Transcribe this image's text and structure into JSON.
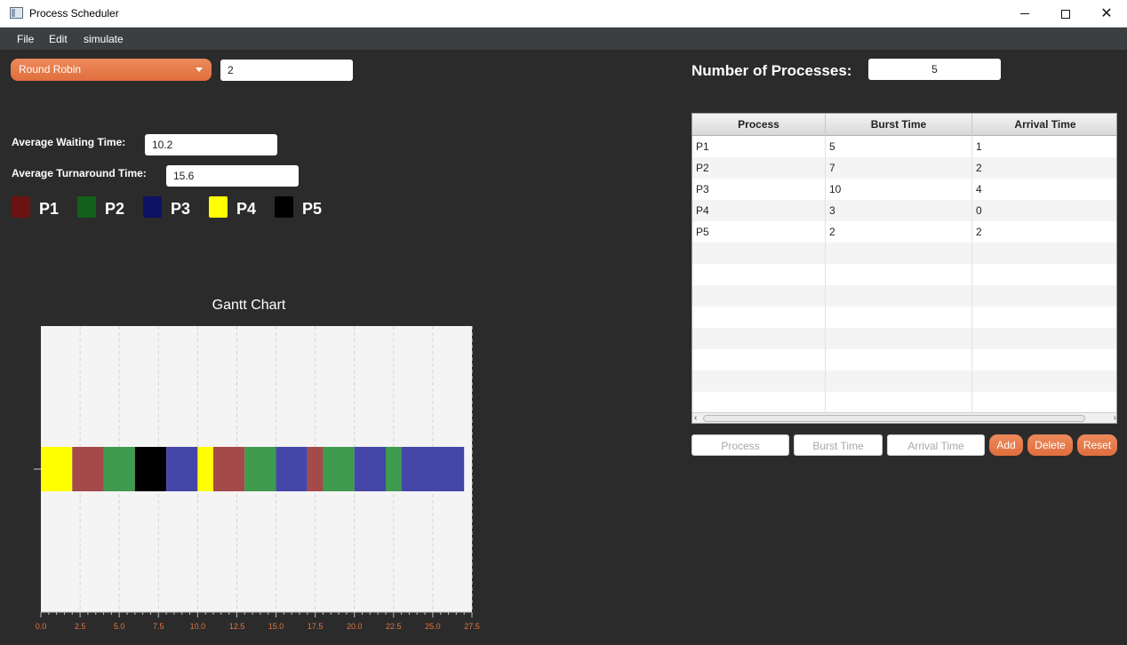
{
  "window": {
    "title": "Process Scheduler"
  },
  "menu": {
    "items": [
      "File",
      "Edit",
      "simulate"
    ]
  },
  "scheduler": {
    "algorithm": "Round Robin",
    "quantum": "2"
  },
  "stats": {
    "avg_waiting_label": "Average Waiting Time:",
    "avg_waiting_value": "10.2",
    "avg_turnaround_label": "Average Turnaround Time:",
    "avg_turnaround_value": "15.6"
  },
  "legend": [
    {
      "label": "P1",
      "color": "#6b1313"
    },
    {
      "label": "P2",
      "color": "#12601b"
    },
    {
      "label": "P3",
      "color": "#0e1264"
    },
    {
      "label": "P4",
      "color": "#ffff00"
    },
    {
      "label": "P5",
      "color": "#000000"
    }
  ],
  "processes_header": {
    "label": "Number of Processes:",
    "value": "5"
  },
  "table": {
    "columns": [
      "Process",
      "Burst Time",
      "Arrival Time"
    ],
    "rows": [
      [
        "P1",
        "5",
        "1"
      ],
      [
        "P2",
        "7",
        "2"
      ],
      [
        "P3",
        "10",
        "4"
      ],
      [
        "P4",
        "3",
        "0"
      ],
      [
        "P5",
        "2",
        "2"
      ]
    ]
  },
  "inputs": {
    "process_placeholder": "Process",
    "burst_placeholder": "Burst Time",
    "arrival_placeholder": "Arrival Time"
  },
  "buttons": {
    "add": "Add",
    "delete": "Delete",
    "reset": "Reset"
  },
  "chart_data": {
    "type": "gantt",
    "title": "Gantt Chart",
    "xlim": [
      0,
      27.5
    ],
    "xticks": [
      "0.0",
      "2.5",
      "5.0",
      "7.5",
      "10.0",
      "12.5",
      "15.0",
      "17.5",
      "20.0",
      "22.5",
      "25.0",
      "27.5"
    ],
    "segments": [
      {
        "process": "P4",
        "start": 0,
        "end": 2,
        "color": "#ffff00"
      },
      {
        "process": "P1",
        "start": 2,
        "end": 4,
        "color": "#a44a4a"
      },
      {
        "process": "P2",
        "start": 4,
        "end": 6,
        "color": "#3f9b4d"
      },
      {
        "process": "P5",
        "start": 6,
        "end": 8,
        "color": "#000000"
      },
      {
        "process": "P3",
        "start": 8,
        "end": 10,
        "color": "#4646a8"
      },
      {
        "process": "P4",
        "start": 10,
        "end": 11,
        "color": "#ffff00"
      },
      {
        "process": "P1",
        "start": 11,
        "end": 13,
        "color": "#a44a4a"
      },
      {
        "process": "P2",
        "start": 13,
        "end": 15,
        "color": "#3f9b4d"
      },
      {
        "process": "P3",
        "start": 15,
        "end": 17,
        "color": "#4646a8"
      },
      {
        "process": "P1",
        "start": 17,
        "end": 18,
        "color": "#a44a4a"
      },
      {
        "process": "P2",
        "start": 18,
        "end": 20,
        "color": "#3f9b4d"
      },
      {
        "process": "P3",
        "start": 20,
        "end": 22,
        "color": "#4646a8"
      },
      {
        "process": "P2",
        "start": 22,
        "end": 23,
        "color": "#3f9b4d"
      },
      {
        "process": "P3",
        "start": 23,
        "end": 27,
        "color": "#4646a8"
      }
    ]
  }
}
